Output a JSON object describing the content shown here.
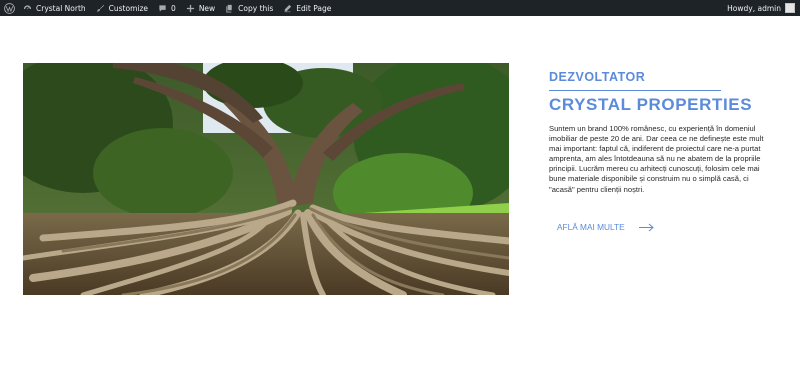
{
  "adminbar": {
    "site_name": "Crystal North",
    "customize": "Customize",
    "comments_count": "0",
    "new": "New",
    "copy": "Copy this",
    "edit": "Edit Page",
    "greeting": "Howdy, admin"
  },
  "section": {
    "eyebrow": "DEZVOLTATOR",
    "title": "CRYSTAL PROPERTIES",
    "description": "Suntem un brand 100% românesc, cu experiență în domeniul imobiliar de peste 20 de ani. Dar ceea ce ne definește este mult mai important: faptul că, indiferent de proiectul care ne-a purtat amprenta, am ales întotdeauna să nu ne abatem de la propriile principii. Lucrăm mereu cu arhitecți cunoscuți, folosim cele mai bune materiale disponibile și construim nu o simplă casă, ci \"acasă\" pentru clienții noștri.",
    "cta_label": "AFLĂ MAI MULTE",
    "image_subject": "tree-with-roots-photo"
  },
  "colors": {
    "accent": "#5b8bd9",
    "adminbar_bg": "#1d2327"
  }
}
